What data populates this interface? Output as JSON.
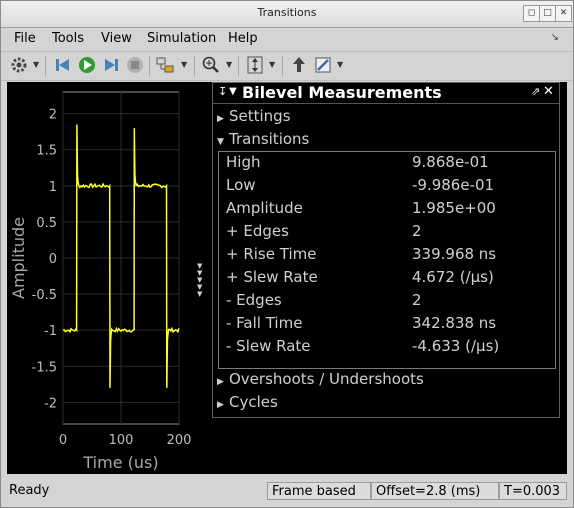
{
  "window": {
    "title": "Transitions"
  },
  "menu": {
    "file": "File",
    "tools": "Tools",
    "view": "View",
    "simulation": "Simulation",
    "help": "Help"
  },
  "plot": {
    "ylabel": "Amplitude",
    "xlabel": "Time (us)",
    "yticks": [
      "2",
      "1.5",
      "1",
      "0.5",
      "0",
      "-0.5",
      "-1",
      "-1.5",
      "-2"
    ],
    "xticks": [
      "0",
      "100",
      "200"
    ],
    "trace_color": "#ffff22"
  },
  "panel": {
    "title": "Bilevel Measurements",
    "settings": "Settings",
    "transitions": "Transitions",
    "overshoots": "Overshoots / Undershoots",
    "cycles": "Cycles",
    "measurements": [
      {
        "label": "High",
        "value": "9.868e-01"
      },
      {
        "label": "Low",
        "value": "-9.986e-01"
      },
      {
        "label": "Amplitude",
        "value": "1.985e+00"
      },
      {
        "label": "+ Edges",
        "value": "2"
      },
      {
        "label": "+ Rise Time",
        "value": "339.968 ns"
      },
      {
        "label": "+ Slew Rate",
        "value": "4.672 (/µs)"
      },
      {
        "label": "- Edges",
        "value": "2"
      },
      {
        "label": "- Fall Time",
        "value": "342.838 ns"
      },
      {
        "label": "- Slew Rate",
        "value": "-4.633 (/µs)"
      }
    ]
  },
  "status": {
    "ready": "Ready",
    "frame": "Frame based",
    "offset": "Offset=2.8 (ms)",
    "time": "T=0.003"
  }
}
